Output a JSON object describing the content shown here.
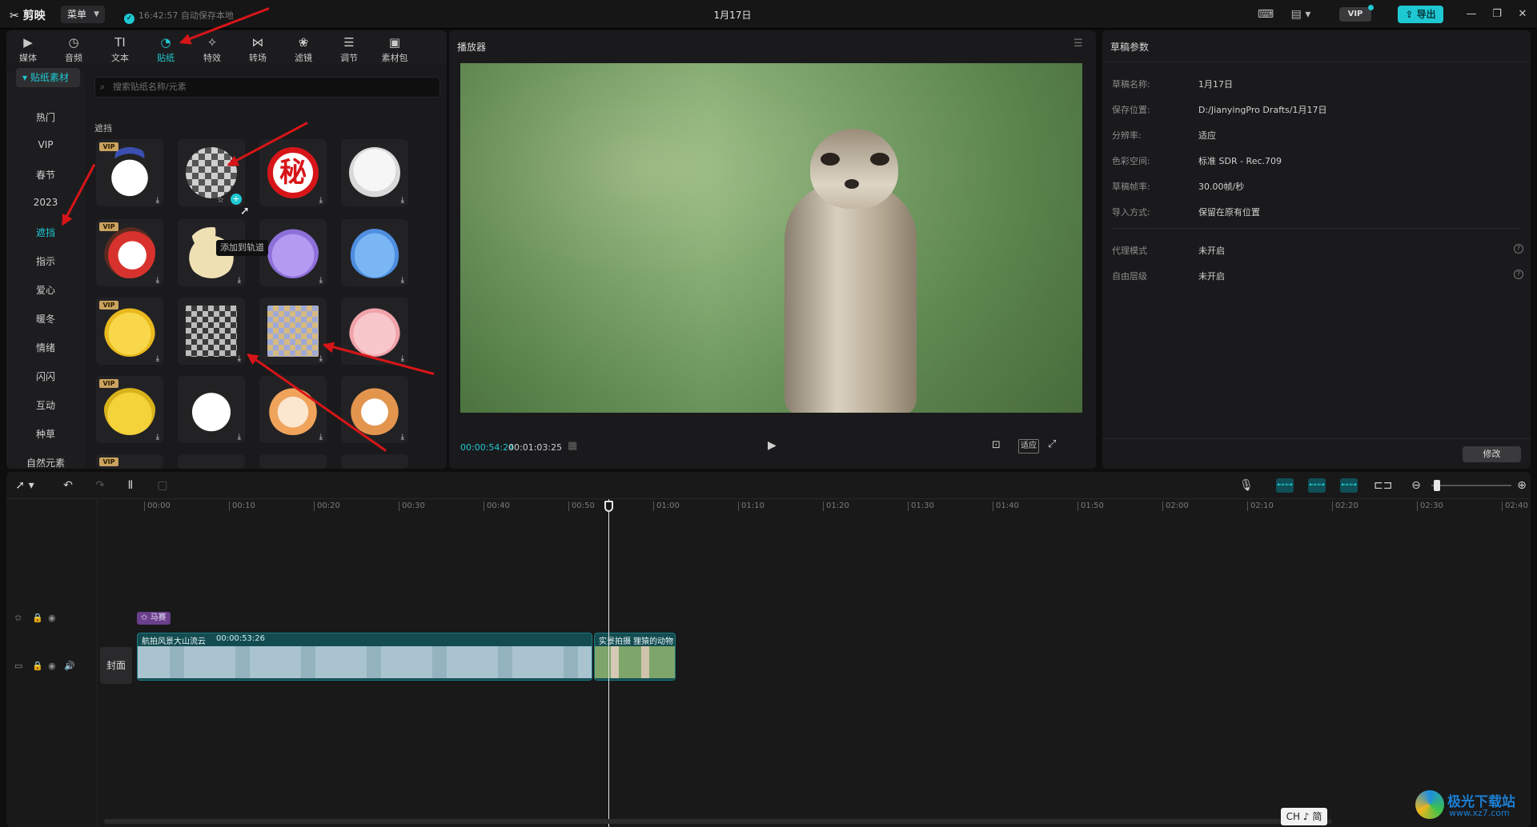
{
  "titlebar": {
    "logo": "剪映",
    "menu_label": "菜单",
    "save_status": "16:42:57 自动保存本地",
    "project_title": "1月17日",
    "vip_label": "VIP",
    "export_label": "导出"
  },
  "toolbar": {
    "tabs": [
      {
        "label": "媒体",
        "icon": "media-icon"
      },
      {
        "label": "音频",
        "icon": "audio-icon"
      },
      {
        "label": "文本",
        "icon": "text-icon"
      },
      {
        "label": "贴纸",
        "icon": "sticker-icon",
        "active": true
      },
      {
        "label": "特效",
        "icon": "effects-icon"
      },
      {
        "label": "转场",
        "icon": "transition-icon"
      },
      {
        "label": "滤镜",
        "icon": "filter-icon"
      },
      {
        "label": "调节",
        "icon": "adjust-icon"
      },
      {
        "label": "素材包",
        "icon": "package-icon"
      }
    ]
  },
  "stickers": {
    "category_header": "贴纸素材",
    "categories": [
      "热门",
      "VIP",
      "春节",
      "2023",
      "遮挡",
      "指示",
      "爱心",
      "暖冬",
      "情绪",
      "闪闪",
      "互动",
      "种草",
      "自然元素"
    ],
    "active_category": "遮挡",
    "search_placeholder": "搜索贴纸名称/元素",
    "section_label": "遮挡",
    "vip_badge": "VIP",
    "tooltip": "添加到轨道",
    "grid_icons": [
      "snoopy-sticker",
      "mosaic-circle-sticker",
      "secret-stamp-sticker",
      "puppy-sticker",
      "duck-sticker",
      "bunny-sticker",
      "purple-cat-sticker",
      "blue-cat-sticker",
      "yellow-chick-sticker",
      "mosaic-square-sticker",
      "color-mosaic-sticker",
      "pig-sticker",
      "pear-sticker",
      "panda-sticker",
      "orange-cat-sticker",
      "shiba-sticker"
    ],
    "stamp_text": "秘"
  },
  "player": {
    "title": "播放器",
    "current_time": "00:00:54:24",
    "total_time": "00:01:03:25",
    "fit_label": "适应"
  },
  "props": {
    "title": "草稿参数",
    "rows": [
      {
        "label": "草稿名称:",
        "value": "1月17日"
      },
      {
        "label": "保存位置:",
        "value": "D:/JianyingPro Drafts/1月17日"
      },
      {
        "label": "分辨率:",
        "value": "适应"
      },
      {
        "label": "色彩空间:",
        "value": "标准 SDR - Rec.709"
      },
      {
        "label": "草稿帧率:",
        "value": "30.00帧/秒"
      },
      {
        "label": "导入方式:",
        "value": "保留在原有位置"
      }
    ],
    "rows2": [
      {
        "label": "代理模式",
        "value": "未开启"
      },
      {
        "label": "自由层级",
        "value": "未开启"
      }
    ],
    "edit_label": "修改"
  },
  "timeline": {
    "ruler": [
      "00:00",
      "00:10",
      "00:20",
      "00:30",
      "00:40",
      "00:50",
      "01:00",
      "01:10",
      "01:20",
      "01:30",
      "01:40",
      "01:50",
      "02:00",
      "02:10",
      "02:20",
      "02:30",
      "02:40"
    ],
    "cover_label": "封面",
    "sticker_clip_label": "马赛",
    "clips": [
      {
        "title": "航拍风景大山流云",
        "duration": "00:00:53:26"
      },
      {
        "title": "实景拍摄 狸猿的动物",
        "duration": ""
      }
    ]
  },
  "ime": "CH ♪ 简",
  "watermark": {
    "line1": "极光下载站",
    "line2": "www.xz7.com"
  },
  "colors": {
    "accent": "#1ec8d2",
    "arrow": "#d71518"
  }
}
